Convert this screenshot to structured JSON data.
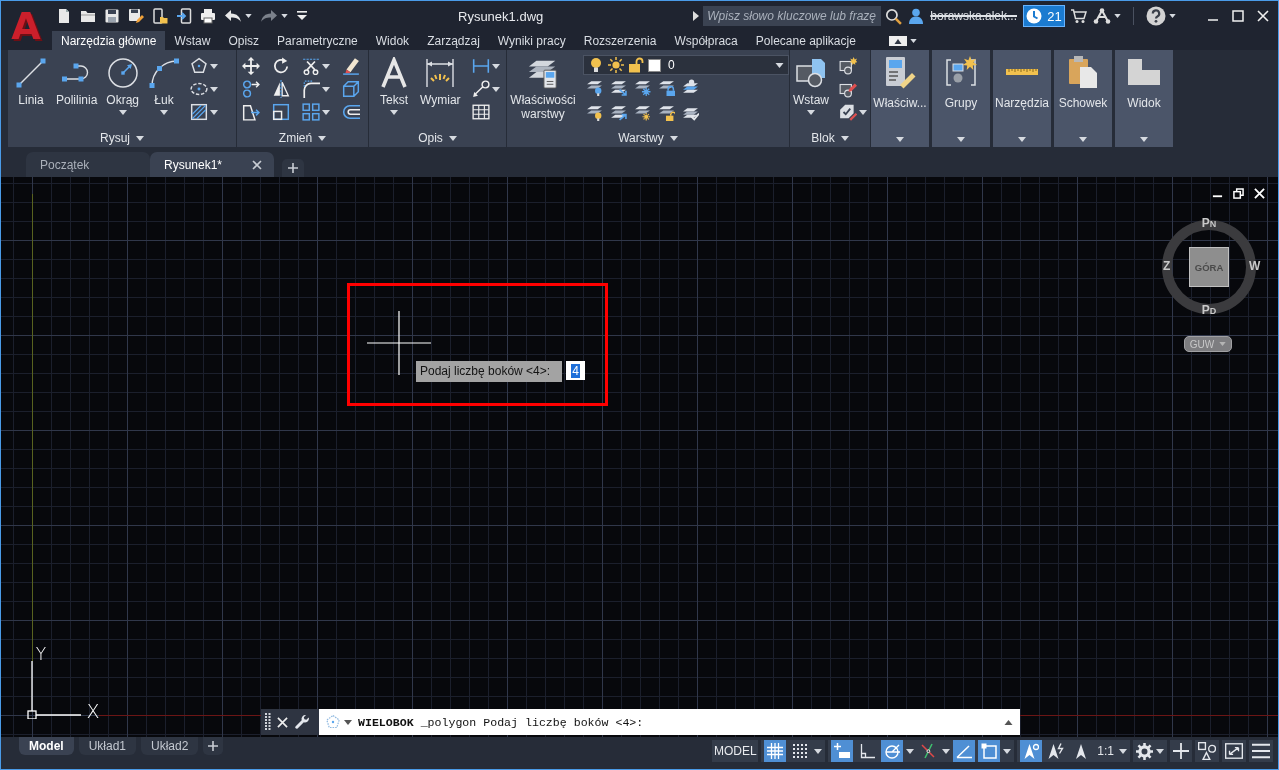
{
  "title_bar": {
    "logo": "A",
    "title": "Rysunek1.dwg",
    "search": {
      "placeholder": "Wpisz słowo kluczowe lub frazę"
    },
    "user": {
      "name": "borawska.alek...",
      "redacted": true
    },
    "notifications": {
      "count": "21"
    }
  },
  "ribbon": {
    "tabs": [
      {
        "label": "Narzędzia główne",
        "selected": true
      },
      {
        "label": "Wstaw",
        "selected": false
      },
      {
        "label": "Opisz",
        "selected": false
      },
      {
        "label": "Parametryczne",
        "selected": false
      },
      {
        "label": "Widok",
        "selected": false
      },
      {
        "label": "Zarządzaj",
        "selected": false
      },
      {
        "label": "Wyniki pracy",
        "selected": false
      },
      {
        "label": "Rozszerzenia",
        "selected": false
      },
      {
        "label": "Współpraca",
        "selected": false
      },
      {
        "label": "Polecane aplikacje",
        "selected": false
      }
    ],
    "panels": [
      {
        "kind": "draw",
        "title": "Rysuj",
        "tools": [
          {
            "label": "Linia",
            "dropdown": false
          },
          {
            "label": "Polilinia",
            "dropdown": false
          },
          {
            "label": "Okrąg",
            "dropdown": true
          },
          {
            "label": "Łuk",
            "dropdown": true
          }
        ]
      },
      {
        "kind": "modify",
        "title": "Zmień"
      },
      {
        "kind": "annotation",
        "title": "Opis",
        "tools": [
          {
            "label": "Tekst",
            "dropdown": true
          },
          {
            "label": "Wymiar",
            "dropdown": false
          }
        ]
      },
      {
        "kind": "layers",
        "title": "Warstwy",
        "tools": [
          {
            "label": "Właściwości warstwy",
            "dropdown": false
          }
        ],
        "current_layer": "0"
      },
      {
        "kind": "block",
        "title": "Blok",
        "tools": [
          {
            "label": "Wstaw",
            "dropdown": true
          }
        ]
      }
    ],
    "collapsed_panels": [
      {
        "kind": "properties",
        "label": "Właściw..."
      },
      {
        "kind": "groups",
        "label": "Grupy"
      },
      {
        "kind": "utilities",
        "label": "Narzędzia"
      },
      {
        "kind": "clipboard",
        "label": "Schowek"
      },
      {
        "kind": "view",
        "label": "Widok"
      }
    ]
  },
  "document_tabs": [
    {
      "label": "Początek",
      "selected": false,
      "closable": false
    },
    {
      "label": "Rysunek1*",
      "selected": true,
      "closable": true
    }
  ],
  "canvas": {
    "view_cube": {
      "face": "GÓRA",
      "north": "PN",
      "south": "PD",
      "west": "Z",
      "east": "W",
      "ucs_menu": "GUW"
    },
    "dynamic_input": {
      "prompt": "Podaj liczbę boków <4>:",
      "value": "4",
      "value_selected": true
    },
    "ucs_icon": {
      "x_label": "X",
      "y_label": "Y"
    }
  },
  "command_line": {
    "text": "**WIELOBOK** _polygon Podaj liczbę boków <4>:"
  },
  "layout_tabs": [
    {
      "label": "Model",
      "selected": true
    },
    {
      "label": "Układ1",
      "selected": false
    },
    {
      "label": "Układ2",
      "selected": false
    }
  ],
  "status_bar": {
    "space": "MODEL",
    "grid_toggles": [
      {
        "kind": "grid",
        "on": true,
        "dropdown": false
      },
      {
        "kind": "snap",
        "on": false,
        "dropdown": true
      }
    ],
    "drafting_toggles": [
      {
        "kind": "infer",
        "on": true,
        "dropdown": false
      },
      {
        "kind": "ortho",
        "on": false,
        "dropdown": false
      },
      {
        "kind": "polar",
        "on": true,
        "dropdown": true
      },
      {
        "kind": "isodraft",
        "on": false,
        "dropdown": true
      },
      {
        "kind": "otrack",
        "on": true,
        "dropdown": false
      },
      {
        "kind": "osnap",
        "on": true,
        "dropdown": true
      }
    ],
    "annotation_toggles": [
      {
        "kind": "annovis",
        "on": true,
        "dropdown": false
      },
      {
        "kind": "autoscale",
        "on": false,
        "dropdown": false
      },
      {
        "kind": "annoscale",
        "on": false,
        "dropdown": false
      }
    ],
    "annotation_scale": "1:1"
  }
}
